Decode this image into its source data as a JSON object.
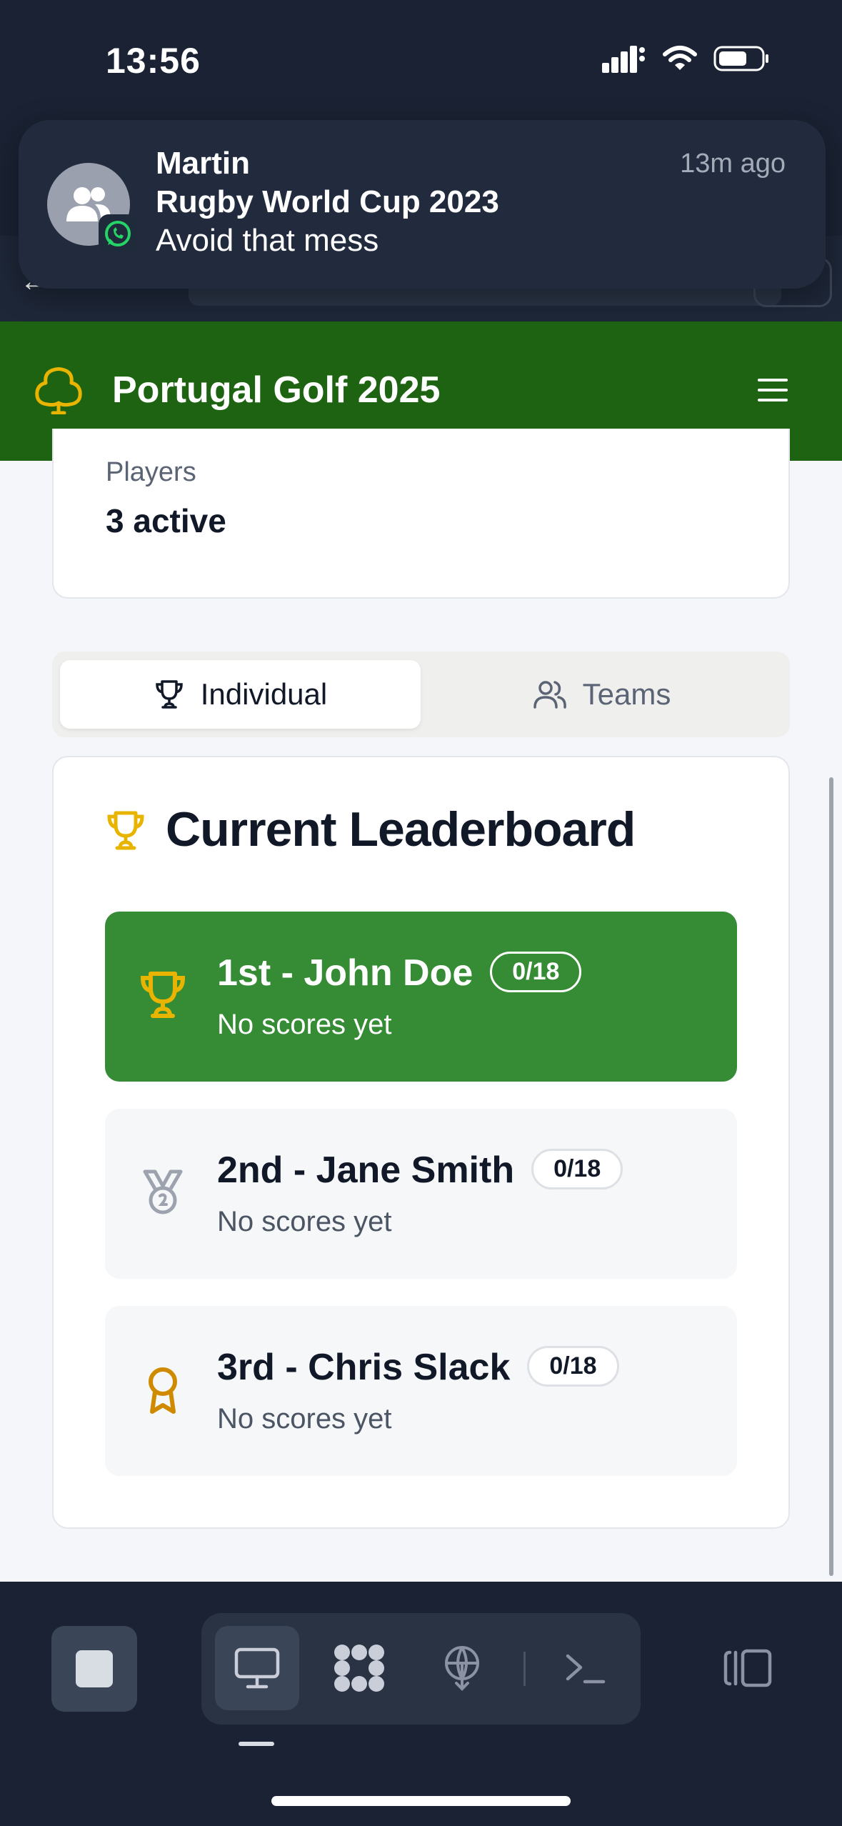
{
  "status_bar": {
    "time": "13:56",
    "icons": [
      "signal-icon",
      "wifi-icon",
      "battery-icon"
    ]
  },
  "notification": {
    "sender": "Martin",
    "title": "Rugby World Cup 2023",
    "body": "Avoid that mess",
    "time": "13m ago",
    "app_icon": "whatsapp-icon"
  },
  "header": {
    "title": "Portugal Golf 2025",
    "logo_icon": "clover-icon",
    "menu_icon": "hamburger-icon"
  },
  "players_card": {
    "label": "Players",
    "value": "3 active"
  },
  "tabs": [
    {
      "label": "Individual",
      "icon": "trophy-icon",
      "selected": true
    },
    {
      "label": "Teams",
      "icon": "users-icon",
      "selected": false
    }
  ],
  "leaderboard": {
    "heading": "Current Leaderboard",
    "entries": [
      {
        "name": "1st - John Doe",
        "progress": "0/18",
        "status": "No scores yet",
        "icon": "trophy-icon"
      },
      {
        "name": "2nd - Jane Smith",
        "progress": "0/18",
        "status": "No scores yet",
        "icon": "medal-icon"
      },
      {
        "name": "3rd - Chris Slack",
        "progress": "0/18",
        "status": "No scores yet",
        "icon": "award-icon"
      }
    ]
  },
  "colors": {
    "header_green": "#1e6312",
    "first_place_green": "#358c35",
    "gold": "#e8b400",
    "dark_bg": "#1a2233"
  },
  "dock": {
    "tools": [
      "stop-icon",
      "desktop-icon",
      "apps-icon",
      "network-icon",
      "terminal-icon",
      "split-view-icon"
    ]
  }
}
